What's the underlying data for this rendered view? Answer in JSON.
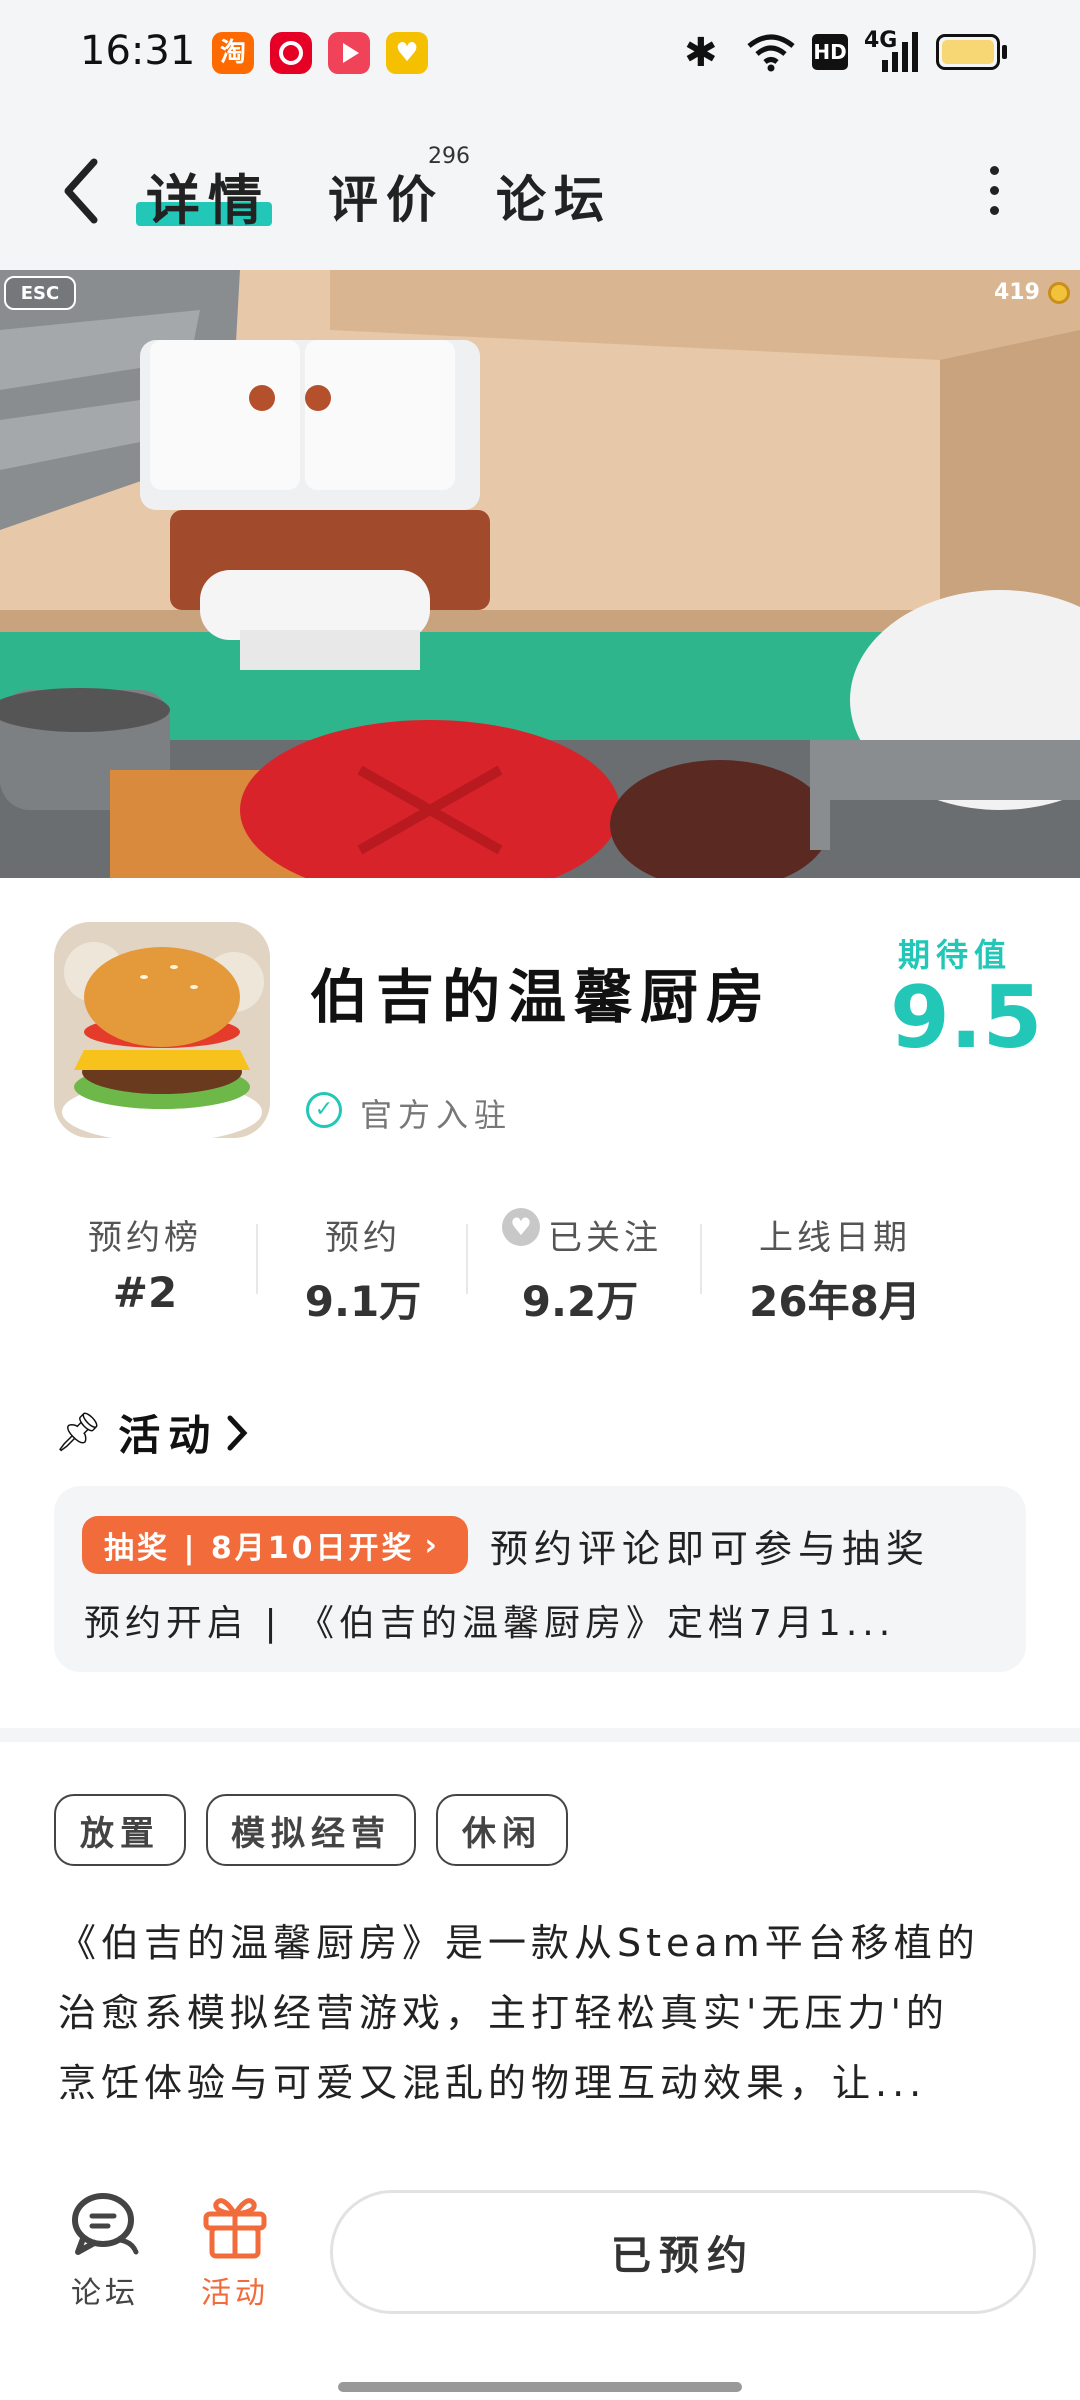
{
  "status_bar": {
    "time": "16:31",
    "app_icons": [
      "taobao-icon",
      "netease-music-icon",
      "video-play-icon",
      "shop-heart-icon"
    ],
    "right_icons": [
      "bluetooth-icon",
      "wifi-icon",
      "hd-icon",
      "signal-4g-icon",
      "battery-icon"
    ],
    "hd_label": "HD",
    "network_label": "4G",
    "battery_color": "#f7d774"
  },
  "nav": {
    "tabs": [
      {
        "label": "详情",
        "active": true
      },
      {
        "label": "评价",
        "count": "296"
      },
      {
        "label": "论坛"
      }
    ],
    "accent": "#22c7b8"
  },
  "banner": {
    "esc_label": "ESC",
    "coin_count": "419"
  },
  "game": {
    "title": "伯吉的温馨厨房",
    "official_label": "官方入驻",
    "expect_label": "期待值",
    "expect_score": "9.5"
  },
  "stats": [
    {
      "label": "预约榜",
      "value": "#2"
    },
    {
      "label": "预约",
      "value": "9.1万"
    },
    {
      "label": "已关注",
      "value": "9.2万"
    },
    {
      "label": "上线日期",
      "value": "26年8月"
    }
  ],
  "activity": {
    "section_title": "活动",
    "badge": "抽奖 | 8月10日开奖",
    "line1": "预约评论即可参与抽奖",
    "line2": "预约开启 | 《伯吉的温馨厨房》定档7月1...",
    "badge_color": "#f26b3a"
  },
  "tags": [
    "放置",
    "模拟经营",
    "休闲"
  ],
  "description": [
    "《伯吉的温馨厨房》是一款从Steam平台移植的",
    "治愈系模拟经营游戏，主打轻松真实'无压力'的",
    "烹饪体验与可爱又混乱的物理互动效果，让..."
  ],
  "bottom_bar": {
    "forum_label": "论坛",
    "activity_label": "活动",
    "reserved_label": "已预约",
    "activity_color": "#f26b3a"
  }
}
